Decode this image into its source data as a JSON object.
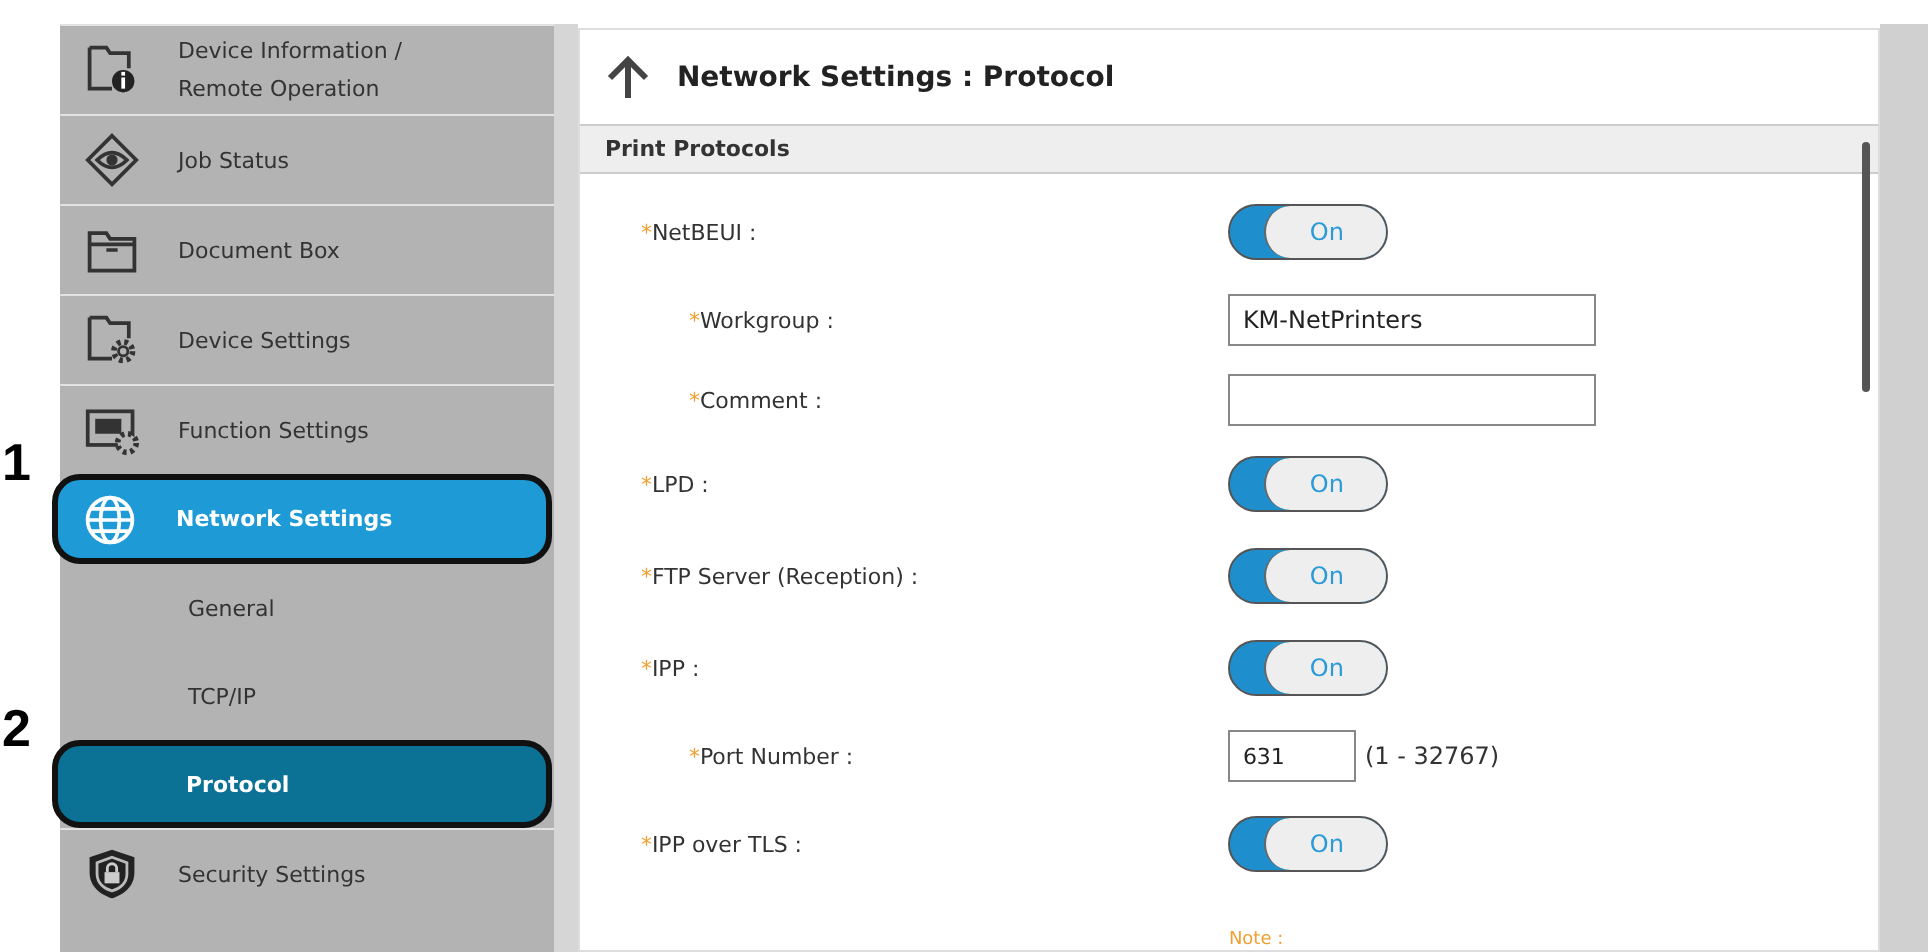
{
  "sidebar": {
    "items": [
      {
        "label": "Device Information / Remote Operation",
        "selected": false
      },
      {
        "label": "Job Status",
        "selected": false
      },
      {
        "label": "Document Box",
        "selected": false
      },
      {
        "label": "Device Settings",
        "selected": false
      },
      {
        "label": "Function Settings",
        "selected": false
      },
      {
        "label": "Network Settings",
        "selected": true,
        "highlighted": true,
        "callout": "1",
        "children": [
          {
            "label": "General",
            "selected": false
          },
          {
            "label": "TCP/IP",
            "selected": false
          },
          {
            "label": "Protocol",
            "selected": true,
            "highlighted": true,
            "callout": "2"
          }
        ]
      },
      {
        "label": "Security Settings",
        "selected": false
      }
    ]
  },
  "panel": {
    "title": "Network Settings : Protocol",
    "section": "Print Protocols",
    "rows": [
      {
        "kind": "toggle",
        "required": "*",
        "label": "NetBEUI :",
        "on": true,
        "value": "On"
      },
      {
        "kind": "text",
        "required": "*",
        "label": "Workgroup :",
        "sub": true,
        "value": "KM-NetPrinters"
      },
      {
        "kind": "text",
        "required": "*",
        "label": "Comment :",
        "sub": true
      },
      {
        "kind": "toggle",
        "required": "*",
        "label": "LPD :",
        "on": true,
        "value": "On"
      },
      {
        "kind": "toggle",
        "required": "*",
        "label": "FTP Server (Reception) :",
        "on": true,
        "value": "On"
      },
      {
        "kind": "toggle",
        "required": "*",
        "label": "IPP :",
        "on": true,
        "value": "On"
      },
      {
        "kind": "number",
        "required": "*",
        "label": "Port Number :",
        "sub": true,
        "value": "631",
        "range": "(1 - 32767)"
      },
      {
        "kind": "toggle",
        "required": "*",
        "label": "IPP over TLS :",
        "on": true,
        "value": "On"
      },
      {
        "kind": "note",
        "note": "Note :"
      }
    ]
  }
}
